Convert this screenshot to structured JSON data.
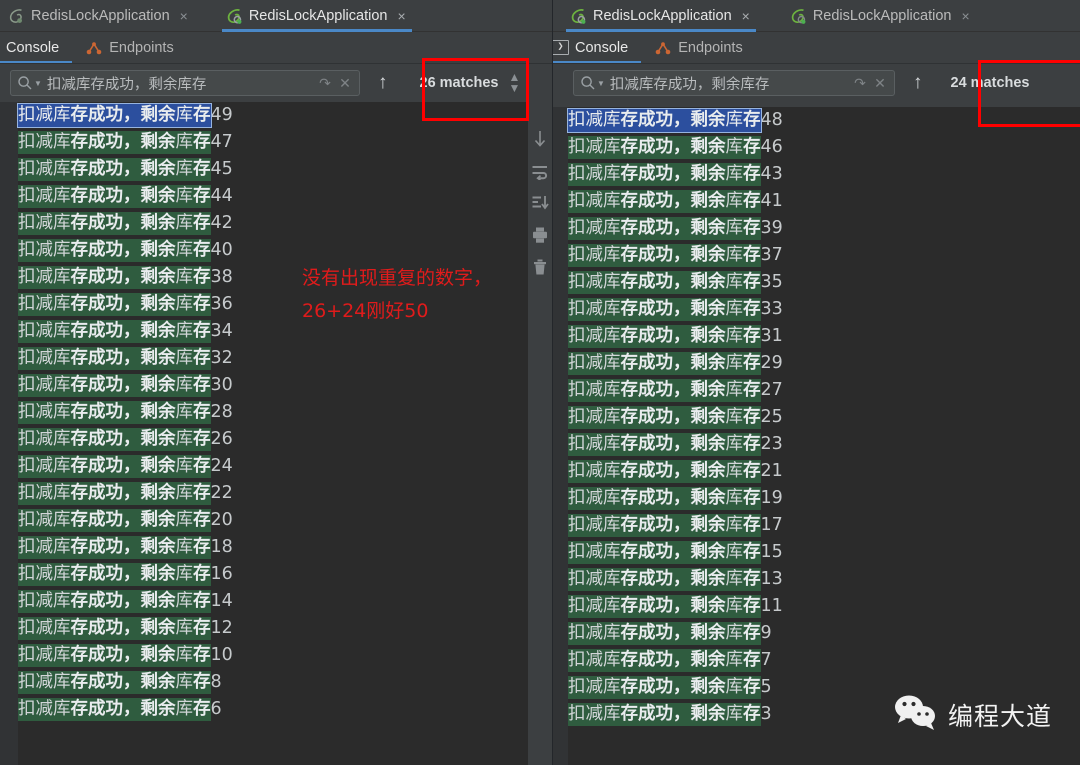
{
  "window_left": {
    "run_tabs": [
      {
        "label": "RedisLockApplication",
        "active": false,
        "icon": "spring-boot-leaf-icon",
        "close": "×"
      },
      {
        "label": "RedisLockApplication",
        "active": true,
        "icon": "spring-boot-leaf-icon",
        "close": "×"
      }
    ],
    "sub_tabs": [
      {
        "label": "Console",
        "active": true,
        "icon": ""
      },
      {
        "label": "Endpoints",
        "active": false,
        "icon": "endpoints-icon"
      }
    ],
    "find": {
      "query": "扣减库存成功，剩余库存",
      "placeholder": "扣减库存成功，剩余库存",
      "matches_label": "26 matches",
      "matches_count": 26,
      "search_icon": "search-icon",
      "filter_icon": "filter-chevron-icon",
      "wrap_icon": "wrap-around-icon",
      "clear_icon": "clear-icon",
      "prev_icon": "arrow-up-icon",
      "next_icon": "arrow-down-icon"
    },
    "side_tools": [
      "scroll-down-icon",
      "soft-wrap-icon",
      "scroll-to-end-icon",
      "print-icon",
      "trash-icon"
    ],
    "log_prefix": "扣减库",
    "log_bold1": "存成功，",
    "log_bold2": "剩余",
    "log_mid": "库",
    "log_bold3": "存",
    "log_values": [
      49,
      47,
      45,
      44,
      42,
      40,
      38,
      36,
      34,
      32,
      30,
      28,
      26,
      24,
      22,
      20,
      18,
      16,
      14,
      12,
      10,
      8,
      6
    ]
  },
  "window_right": {
    "run_tabs": [
      {
        "label": "RedisLockApplication",
        "active": true,
        "icon": "spring-boot-leaf-icon",
        "close": "×"
      },
      {
        "label": "RedisLockApplication",
        "active": false,
        "icon": "spring-boot-leaf-icon",
        "close": "×"
      }
    ],
    "sub_tabs": [
      {
        "label": "Console",
        "active": true,
        "icon": "console-icon"
      },
      {
        "label": "Endpoints",
        "active": false,
        "icon": "endpoints-icon"
      }
    ],
    "find": {
      "query": "扣减库存成功，剩余库存",
      "placeholder": "扣减库存成功，剩余库存",
      "matches_label": "24 matches",
      "matches_count": 24,
      "search_icon": "search-icon",
      "filter_icon": "filter-chevron-icon",
      "wrap_icon": "wrap-around-icon",
      "clear_icon": "clear-icon",
      "prev_icon": "arrow-up-icon"
    },
    "log_prefix": "扣减库",
    "log_bold1": "存成功，",
    "log_bold2": "剩余",
    "log_mid": "库",
    "log_bold3": "存",
    "log_values": [
      48,
      46,
      43,
      41,
      39,
      37,
      35,
      33,
      31,
      29,
      27,
      25,
      23,
      21,
      19,
      17,
      15,
      13,
      11,
      9,
      7,
      5,
      3
    ]
  },
  "annotation": {
    "note_text": "没有出现重复的数字，26+24刚好50",
    "box_color": "#ff0000",
    "text_color": "#e01b1b"
  },
  "watermark": {
    "text": "编程大道",
    "icon": "wechat-icon"
  },
  "colors": {
    "app_bg": "#3c3f41",
    "console_bg": "#2b2b2b",
    "match_highlight": "#2f5c3f",
    "current_match": "#2c4f9e",
    "tab_underline": "#4a88c7",
    "endpoints_icon": "#cc6633"
  }
}
